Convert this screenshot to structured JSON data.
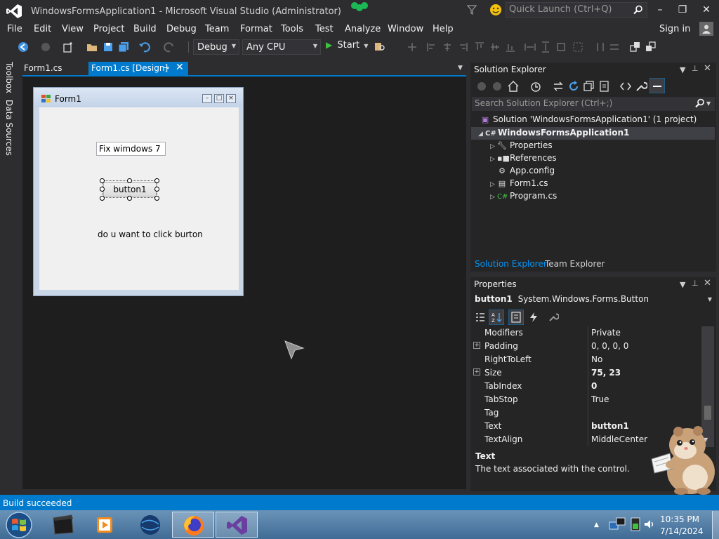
{
  "window": {
    "title": "WindowsFormsApplication1 - Microsoft Visual Studio (Administrator)",
    "quick_launch_placeholder": "Quick Launch (Ctrl+Q)",
    "minimize": "–",
    "maximize": "❐",
    "close": "✕"
  },
  "menu": {
    "items": [
      "File",
      "Edit",
      "View",
      "Project",
      "Build",
      "Debug",
      "Team",
      "Format",
      "Tools",
      "Test",
      "Analyze",
      "Window",
      "Help"
    ],
    "sign_in": "Sign in"
  },
  "toolbar": {
    "config": "Debug",
    "platform": "Any CPU",
    "start": "Start"
  },
  "left_strip": {
    "toolbox": "Toolbox",
    "data_sources": "Data Sources"
  },
  "doc_tabs": {
    "tab1": "Form1.cs",
    "tab2": "Form1.cs [Design]"
  },
  "form": {
    "title": "Form1",
    "textbox_value": "Fix wimdows 7",
    "button_label": "button1",
    "label_text": "do u want to click burton"
  },
  "solution_explorer": {
    "title": "Solution Explorer",
    "search_placeholder": "Search Solution Explorer (Ctrl+;)",
    "solution": "Solution 'WindowsFormsApplication1' (1 project)",
    "project": "WindowsFormsApplication1",
    "items": [
      "Properties",
      "References",
      "App.config",
      "Form1.cs",
      "Program.cs"
    ],
    "tab_active": "Solution Explorer",
    "tab_other": "Team Explorer"
  },
  "properties": {
    "title": "Properties",
    "object_name": "button1",
    "object_type": "System.Windows.Forms.Button",
    "rows": [
      {
        "name": "Modifiers",
        "value": "Private"
      },
      {
        "name": "Padding",
        "value": "0, 0, 0, 0"
      },
      {
        "name": "RightToLeft",
        "value": "No"
      },
      {
        "name": "Size",
        "value": "75, 23"
      },
      {
        "name": "TabIndex",
        "value": "0"
      },
      {
        "name": "TabStop",
        "value": "True"
      },
      {
        "name": "Tag",
        "value": ""
      },
      {
        "name": "Text",
        "value": "button1"
      },
      {
        "name": "TextAlign",
        "value": "MiddleCenter"
      }
    ],
    "description_title": "Text",
    "description_text": "The text associated with the control."
  },
  "status": {
    "text": "Build succeeded"
  },
  "taskbar": {
    "time": "10:35 PM",
    "date": "7/14/2024"
  },
  "colors": {
    "accent": "#007acc",
    "background": "#2d2d30",
    "designer": "#1e1e1e"
  }
}
